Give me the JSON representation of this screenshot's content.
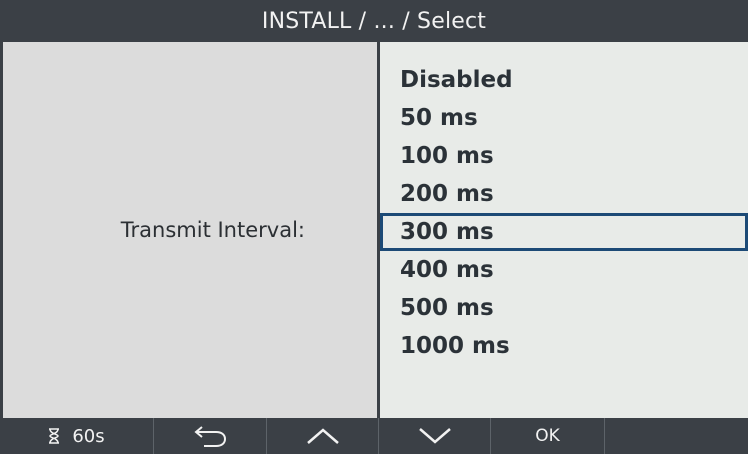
{
  "header": {
    "title": "INSTALL / ... / Select"
  },
  "field": {
    "label": "Transmit Interval:"
  },
  "options": [
    {
      "label": "Disabled"
    },
    {
      "label": "50 ms"
    },
    {
      "label": "100 ms"
    },
    {
      "label": "200 ms"
    },
    {
      "label": "300 ms"
    },
    {
      "label": "400 ms"
    },
    {
      "label": "500 ms"
    },
    {
      "label": "1000 ms"
    }
  ],
  "selected_option": "300 ms",
  "footer": {
    "timer_icon": "hourglass-icon",
    "timer_label": "60s",
    "back_icon": "back-arrow-icon",
    "up_icon": "chevron-up-icon",
    "down_icon": "chevron-down-icon",
    "ok_label": "OK"
  },
  "colors": {
    "bar_background": "#3b4046",
    "left_panel": "#dcdcdc",
    "right_panel": "#e8ebe8",
    "selection_border": "#1c4a76",
    "text_dark": "#2b3238",
    "text_light": "#f2f2f2"
  }
}
